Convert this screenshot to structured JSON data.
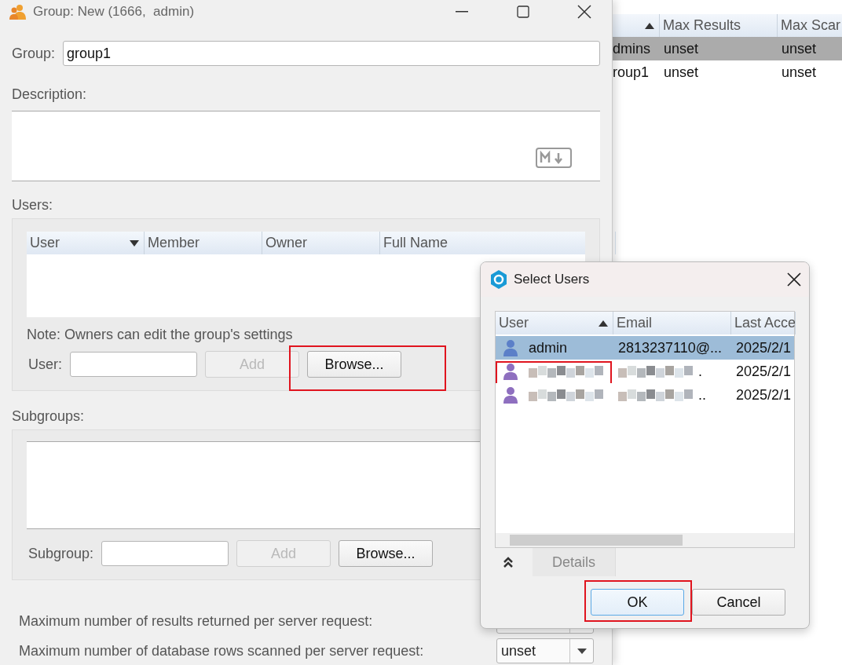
{
  "window": {
    "title": "Group: New (1666,  admin)"
  },
  "group_field": {
    "label": "Group:",
    "value": "group1"
  },
  "description": {
    "label": "Description:"
  },
  "users": {
    "label": "Users:",
    "columns": [
      {
        "label": "User",
        "sort_ascending": false
      },
      {
        "label": "Member"
      },
      {
        "label": "Owner"
      },
      {
        "label": "Full Name"
      }
    ],
    "note": "Note: Owners can edit the group's settings",
    "field_label": "User:",
    "buttons": [
      {
        "label": "Add",
        "disabled": true,
        "highlighted": false
      },
      {
        "label": "Browse...",
        "disabled": false,
        "highlighted": true
      }
    ]
  },
  "subgroups": {
    "label": "Subgroups:",
    "field_label": "Subgroup:",
    "buttons": [
      {
        "label": "Add",
        "disabled": true,
        "highlighted": false
      },
      {
        "label": "Browse...",
        "disabled": false,
        "highlighted": false
      }
    ]
  },
  "limits": [
    {
      "label": "Maximum number of results returned per server request:"
    },
    {
      "label": "Maximum number of database rows scanned per server request:",
      "value": "unset"
    }
  ],
  "background_table": {
    "columns": [
      {
        "sort_ascending": true
      },
      {
        "label": "Max Results"
      },
      {
        "label": "Max Scar"
      }
    ],
    "rows": [
      {
        "cells": [
          "dmins",
          "unset",
          "unset"
        ],
        "selected": true
      },
      {
        "cells": [
          "roup1",
          "unset",
          "unset"
        ],
        "selected": false
      }
    ]
  },
  "select_users": {
    "title": "Select Users",
    "columns": [
      {
        "label": "User",
        "sort_ascending": true
      },
      {
        "label": "Email"
      },
      {
        "label": "Last Acce"
      }
    ],
    "rows": [
      {
        "kind": "plain",
        "user": "admin",
        "email": "2813237110@...",
        "last_access": "2025/2/1",
        "selected": true,
        "highlighted": false
      },
      {
        "kind": "redacted",
        "email": ".",
        "last_access": "2025/2/1",
        "selected": false,
        "highlighted": true
      },
      {
        "kind": "redacted",
        "email": "..",
        "last_access": "2025/2/1",
        "selected": false,
        "highlighted": false
      }
    ],
    "details_tab": "Details",
    "buttons": [
      {
        "label": "OK",
        "default": true,
        "highlighted": true
      },
      {
        "label": "Cancel",
        "default": false,
        "highlighted": false
      }
    ]
  }
}
